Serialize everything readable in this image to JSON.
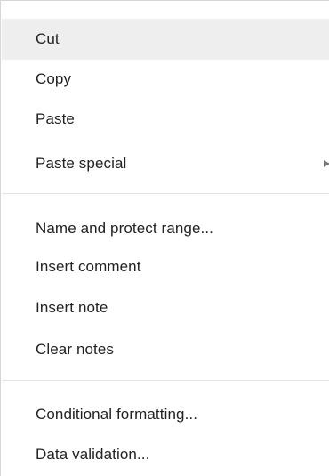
{
  "context_menu": {
    "items": [
      {
        "label": "Cut"
      },
      {
        "label": "Copy"
      },
      {
        "label": "Paste"
      },
      {
        "label": "Paste special"
      },
      {
        "label": "Name and protect range..."
      },
      {
        "label": "Insert comment"
      },
      {
        "label": "Insert note"
      },
      {
        "label": "Clear notes"
      },
      {
        "label": "Conditional formatting..."
      },
      {
        "label": "Data validation..."
      }
    ],
    "highlighted_item": "Cut",
    "submenu_indicator_icon": "triangle-right-icon",
    "colors": {
      "text": "#222222",
      "highlight": "#eeeeee",
      "separator": "#e3e3e3",
      "arrow": "#777777"
    }
  }
}
